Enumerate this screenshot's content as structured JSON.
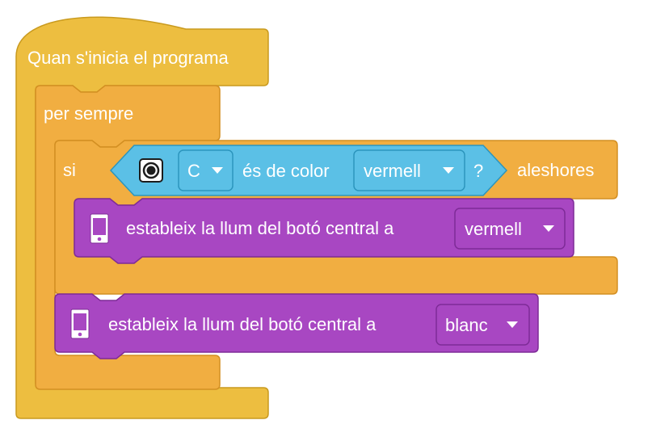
{
  "colors": {
    "event_fill": "#EDBE40",
    "event_stroke": "#C99A1E",
    "control_fill": "#F1AE41",
    "control_stroke": "#D38F22",
    "sensor_fill": "#5BC0E6",
    "sensor_stroke": "#2C95BD",
    "light_fill": "#A847C2",
    "light_stroke": "#7E2B97",
    "text": "#FFFFFF"
  },
  "blocks": {
    "hat": {
      "label": "Quan s'inicia el programa"
    },
    "forever": {
      "label": "per sempre"
    },
    "if_block": {
      "if_label": "si",
      "then_label": "aleshores",
      "condition": {
        "sensor_icon": "color-sensor-icon",
        "port": "C",
        "is_color_label": "és de color",
        "color_value": "vermell",
        "question_mark": "?"
      }
    },
    "set_light_inner": {
      "icon": "hub-icon",
      "label": "estableix la llum del botó central a",
      "color_value": "vermell"
    },
    "set_light_outer": {
      "icon": "hub-icon",
      "label": "estableix la llum del botó central a",
      "color_value": "blanc"
    }
  }
}
